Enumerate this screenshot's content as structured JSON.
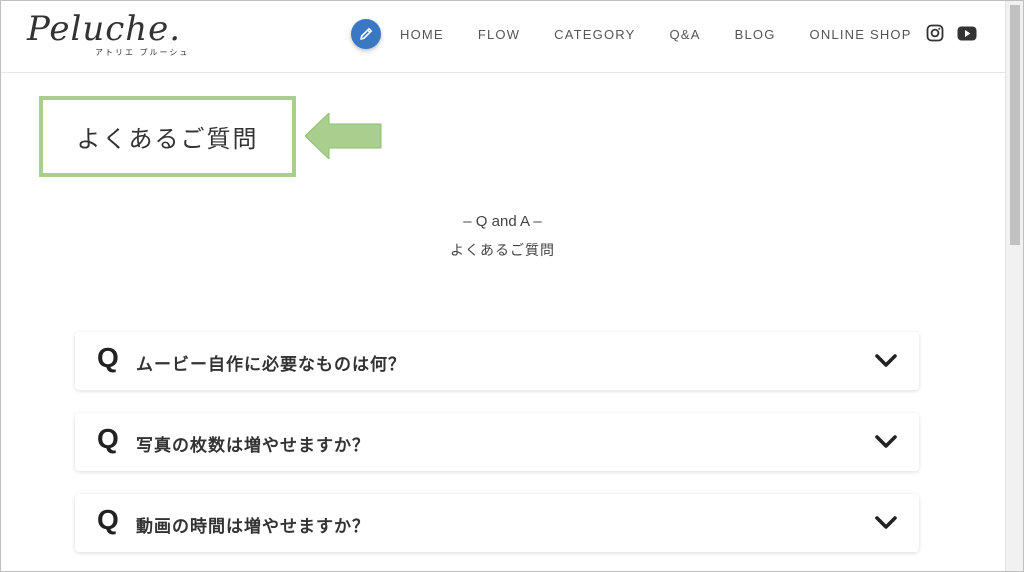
{
  "logo": {
    "script": "Peluche.",
    "subtitle": "アトリエ プルーシュ"
  },
  "nav": {
    "items": [
      {
        "label": "HOME"
      },
      {
        "label": "FLOW"
      },
      {
        "label": "CATEGORY"
      },
      {
        "label": "Q&A"
      },
      {
        "label": "BLOG"
      },
      {
        "label": "ONLINE SHOP"
      }
    ]
  },
  "social": [
    "instagram-icon",
    "youtube-icon"
  ],
  "callout": {
    "text": "よくあるご質問",
    "border_color": "#a9cf8e"
  },
  "section": {
    "sub": "– Q and A –",
    "title": "よくあるご質問"
  },
  "faq": {
    "marker": "Q",
    "items": [
      {
        "question": "ムービー自作に必要なものは何？"
      },
      {
        "question": "写真の枚数は増やせますか？"
      },
      {
        "question": "動画の時間は増やせますか？"
      }
    ]
  },
  "colors": {
    "accent": "#3a78c3",
    "nav_text": "#555555"
  }
}
